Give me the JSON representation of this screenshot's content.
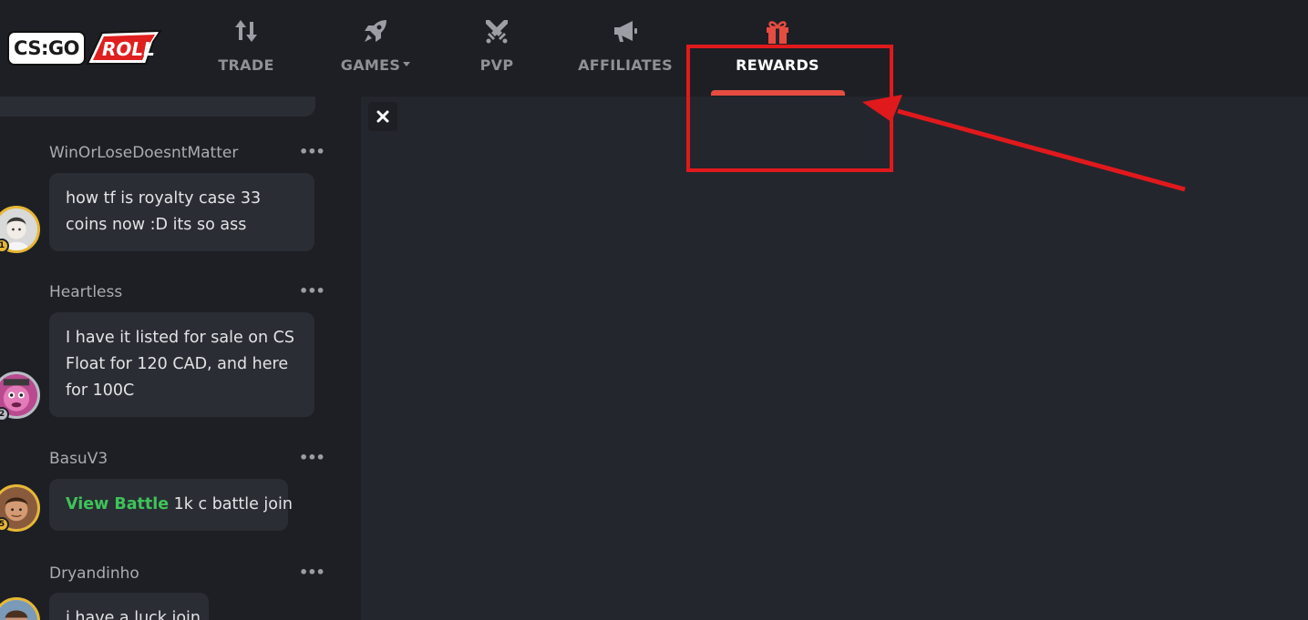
{
  "brand": {
    "logo_text": "CS:GO",
    "logo_script": "ROLL",
    "colors": {
      "accent": "#e64c41",
      "gold": "#e7b734",
      "link_green": "#3ec35a",
      "annotation_red": "#e0191d"
    }
  },
  "nav": {
    "items": [
      {
        "label": "TRADE",
        "icon": "arrows-up-down-icon"
      },
      {
        "label": "GAMES",
        "icon": "rocket-icon",
        "has_dropdown": true
      },
      {
        "label": "PVP",
        "icon": "crossed-swords-icon"
      },
      {
        "label": "AFFILIATES",
        "icon": "megaphone-icon"
      },
      {
        "label": "REWARDS",
        "icon": "gift-icon",
        "active": true
      }
    ]
  },
  "chat": {
    "messages": [
      {
        "username": "WinOrLoseDoesntMatter",
        "text": "how tf is royalty case 33 coins now :D its so ass",
        "level": "1",
        "badge": "gold"
      },
      {
        "username": "Heartless",
        "text": "I have it listed for sale on CS Float for 120 CAD, and here for 100C",
        "level": "2",
        "badge": "silver"
      },
      {
        "username": "BasuV3",
        "link": "View Battle",
        "text": " 1k c battle join",
        "level": "5",
        "badge": "gold"
      },
      {
        "username": "Dryandinho",
        "text": "i have a luck join",
        "level": "",
        "badge": "gold"
      }
    ]
  },
  "main": {
    "close_icon": "close-icon"
  }
}
